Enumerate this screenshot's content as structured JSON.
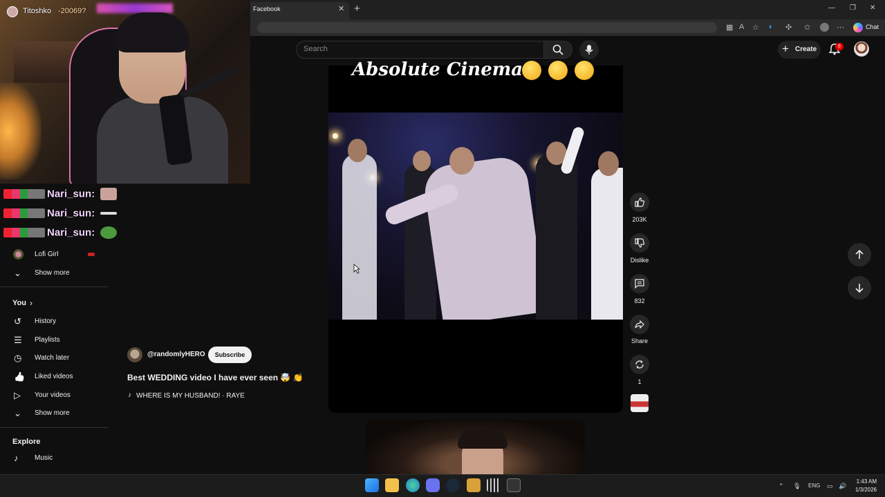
{
  "browser": {
    "tab_title": "Facebook",
    "tab_close": "✕",
    "new_tab": "+",
    "window": {
      "minimize": "—",
      "restore": "❐",
      "close": "✕"
    },
    "toolbar_chat": "Chat",
    "toolbar_more": "⋯"
  },
  "youtube": {
    "search_placeholder": "Search",
    "create_label": "Create",
    "create_plus": "+",
    "notification_count": "6"
  },
  "stream": {
    "streamer_name": "Titoshko",
    "viewer_count": "-20069?",
    "chat": [
      {
        "user": "Nari_sun:",
        "emote_color": "#c9a39a"
      },
      {
        "user": "Nari_sun:",
        "emote_color": "#2a2a2a"
      },
      {
        "user": "Nari_sun:",
        "emote_color": "#4c9a3e"
      }
    ]
  },
  "sidebar": {
    "subscriptions_tail": [
      {
        "label": "Lofi Girl",
        "icon": "channel-avatar"
      }
    ],
    "show_more_1": "Show more",
    "you_heading": "You",
    "you_chevron": "›",
    "you_items": [
      {
        "label": "History",
        "icon": "history-icon",
        "glyph": "↺"
      },
      {
        "label": "Playlists",
        "icon": "playlists-icon",
        "glyph": "☰"
      },
      {
        "label": "Watch later",
        "icon": "clock-icon",
        "glyph": "◷"
      },
      {
        "label": "Liked videos",
        "icon": "thumb-up-icon",
        "glyph": "👍"
      },
      {
        "label": "Your videos",
        "icon": "play-square-icon",
        "glyph": "▷"
      }
    ],
    "show_more_2": "Show more",
    "explore_heading": "Explore",
    "explore_items": [
      {
        "label": "Music",
        "icon": "music-icon",
        "glyph": "♪"
      }
    ],
    "chevron": "⌄"
  },
  "short": {
    "channel_handle": "@randomlyHERO",
    "subscribe_label": "Subscribe",
    "title": "Best WEDDING video I have ever seen 🤯 👏",
    "music_note": "♪",
    "music": "WHERE IS MY HUSBAND! · RAYE",
    "caption_text": "Absolute Cinema",
    "actions": {
      "like_count": "203K",
      "dislike_label": "Dislike",
      "comment_count": "832",
      "share_label": "Share",
      "remix_count": "1"
    }
  },
  "taskbar": {
    "tray_lang": "ENG",
    "tray_chevron": "⌃",
    "clock_time": "1:43 AM",
    "clock_date": "1/3/2026",
    "apps": [
      {
        "name": "start-button",
        "color": "#3aa0ff"
      },
      {
        "name": "file-explorer",
        "color": "#f3c14b"
      },
      {
        "name": "edge-browser",
        "color": "#1fa0c8"
      },
      {
        "name": "discord",
        "color": "#6a72f0"
      },
      {
        "name": "steam",
        "color": "#2a475e"
      },
      {
        "name": "app-badge",
        "color": "#d9a13a"
      },
      {
        "name": "app-bars",
        "color": "#c8c8c8"
      },
      {
        "name": "epic-games",
        "color": "#333333"
      }
    ]
  }
}
